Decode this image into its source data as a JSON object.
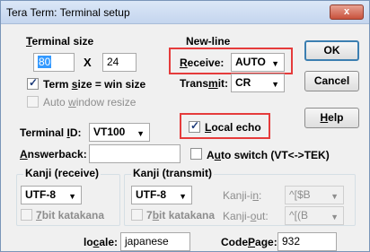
{
  "window": {
    "title": "Tera Term: Terminal setup",
    "close_glyph": "x"
  },
  "terminal_size": {
    "label": "Terminal size",
    "cols": "80",
    "times": "X",
    "rows": "24",
    "term_size_label": "Term size = win size",
    "auto_resize_label": "Auto window resize"
  },
  "newline": {
    "label": "New-line",
    "receive_label": "Receive:",
    "receive_value": "AUTO",
    "transmit_label": "Transmit:",
    "transmit_value": "CR"
  },
  "buttons": {
    "ok": "OK",
    "cancel": "Cancel",
    "help": "Help"
  },
  "terminal_id": {
    "label": "Terminal ID:",
    "value": "VT100"
  },
  "local_echo": {
    "label": "Local echo"
  },
  "answerback": {
    "label": "Answerback:",
    "value": ""
  },
  "auto_switch": {
    "label": "Auto switch (VT<->TEK)"
  },
  "kanji_receive": {
    "label": "Kanji (receive)",
    "value": "UTF-8",
    "katakana": "7bit katakana"
  },
  "kanji_transmit": {
    "label": "Kanji (transmit)",
    "value": "UTF-8",
    "katakana": "7bit katakana",
    "kanji_in_label": "Kanji-in:",
    "kanji_in_value": "^[$B",
    "kanji_out_label": "Kanji-out:",
    "kanji_out_value": "^[(B"
  },
  "locale": {
    "label": "locale:",
    "value": "japanese"
  },
  "codepage": {
    "label": "CodePage:",
    "value": "932"
  }
}
